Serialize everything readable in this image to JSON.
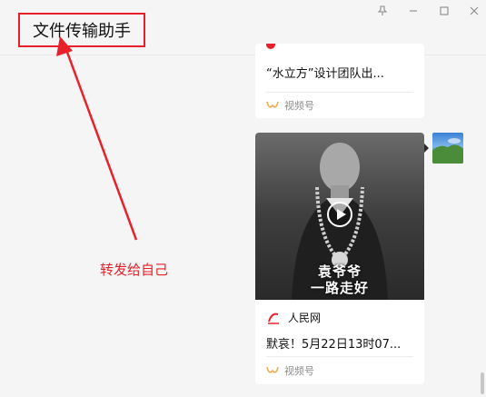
{
  "window": {
    "title": "文件传输助手",
    "controls": {
      "pin": "pin-icon",
      "minimize": "minimize-icon",
      "maximize": "maximize-icon",
      "close": "close-icon"
    }
  },
  "messages": [
    {
      "title": "“水立方”设计团队出...",
      "footer_label": "视频号"
    },
    {
      "overlay_line1": "袁爷爷",
      "overlay_line2": "一路走好",
      "source": "人民网",
      "title": "默哀！5月22日13时07...",
      "footer_label": "视频号"
    }
  ],
  "annotation": {
    "text": "转发给自己",
    "color": "#e8202a"
  },
  "colors": {
    "accent_red": "#e8202a",
    "channels_icon": "#f2a94b"
  }
}
